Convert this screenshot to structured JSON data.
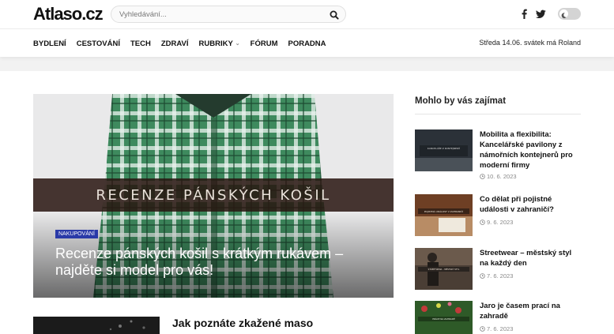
{
  "header": {
    "logo": "Atlaso.cz",
    "search_placeholder": "Vyhledávání...",
    "social": [
      "facebook-icon",
      "twitter-icon"
    ]
  },
  "nav": {
    "items": [
      {
        "label": "BYDLENÍ"
      },
      {
        "label": "CESTOVÁNÍ"
      },
      {
        "label": "TECH"
      },
      {
        "label": "ZDRAVÍ"
      },
      {
        "label": "RUBRIKY",
        "dropdown": true
      },
      {
        "label": "FÓRUM"
      },
      {
        "label": "PORADNA"
      }
    ],
    "date": "Středa 14.06. svátek má Roland"
  },
  "hero": {
    "image_caption": "RECENZE PÁNSKÝCH KOŠIL",
    "category": "NAKUPOVÁNÍ",
    "title": "Recenze pánských košil s krátkým rukávem – najděte si model pro vás!"
  },
  "secondary": {
    "title": "Jak poznáte zkažené maso"
  },
  "sidebar": {
    "heading": "Mohlo by vás zajímat",
    "items": [
      {
        "title": "Mobilita a flexibilita: Kancelářské pavilony z námořních kontejnerů pro moderní firmy",
        "date": "10. 6. 2023",
        "thumb_text": "KANCELÁŘE Z KONTEJNERŮ"
      },
      {
        "title": "Co dělat při pojistné události v zahraničí?",
        "date": "9. 6. 2023",
        "thumb_text": "POJISTNÁ UDÁLOST V ZAHRANIČÍ"
      },
      {
        "title": "Streetwear – městský styl na každý den",
        "date": "7. 6. 2023",
        "thumb_text": "STREETWEAR – MĚSTSKÝ STYL"
      },
      {
        "title": "Jaro je časem prací na zahradě",
        "date": "7. 6. 2023",
        "thumb_text": "PRÁCE NA ZAHRADĚ"
      }
    ]
  },
  "colors": {
    "badge": "#2a3aa8",
    "hero_green": "#2f6a4a"
  }
}
